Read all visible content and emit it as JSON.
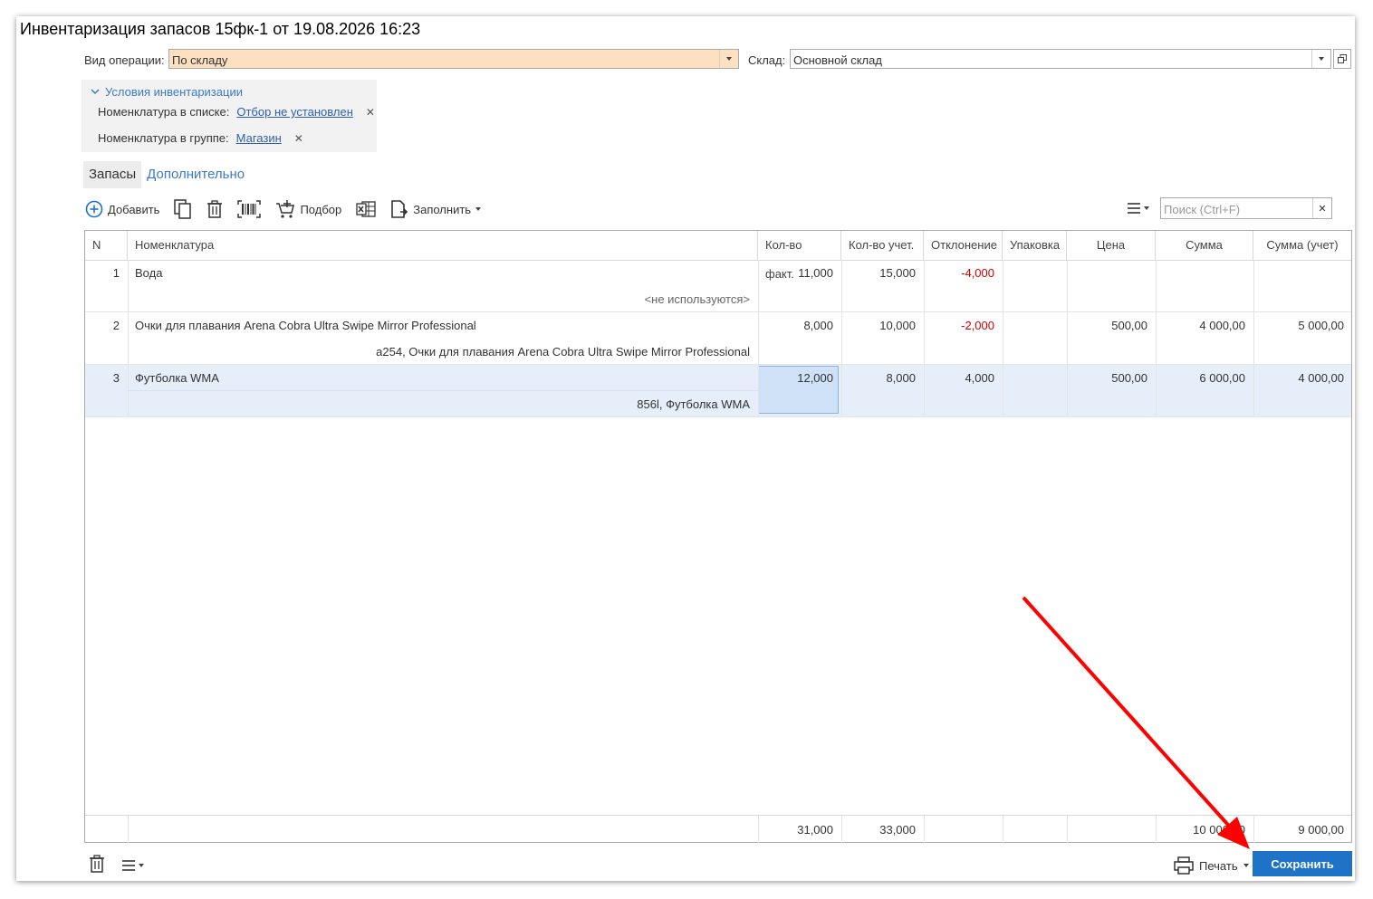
{
  "window": {
    "title": "Инвентаризация запасов 15фк-1 от 19.08.2026 16:23"
  },
  "header": {
    "operation_label": "Вид операции:",
    "operation_value": "По складу",
    "warehouse_label": "Склад:",
    "warehouse_value": "Основной склад"
  },
  "conditions": {
    "title": "Условия инвентаризации",
    "list_label": "Номенклатура в списке:",
    "list_value": "Отбор не установлен",
    "group_label": "Номенклатура в группе:",
    "group_value": "Магазин"
  },
  "tabs": [
    {
      "label": "Запасы"
    },
    {
      "label": "Дополнительно"
    }
  ],
  "toolbar": {
    "add_label": "Добавить",
    "pick_label": "Подбор",
    "fill_label": "Заполнить",
    "search_placeholder": "Поиск (Ctrl+F)"
  },
  "table": {
    "columns": [
      "N",
      "Номенклатура",
      "Кол-во факт.",
      "Кол-во учет.",
      "Отклонение",
      "Упаковка",
      "Цена",
      "Сумма",
      "Сумма (учет)"
    ],
    "rows": [
      {
        "n": "1",
        "name": "Вода",
        "sub": "<не используются>",
        "fact": "11,000",
        "acc": "15,000",
        "dev": "-4,000",
        "pack": "",
        "price": "",
        "sum": "",
        "sum_acc": ""
      },
      {
        "n": "2",
        "name": "Очки для плавания Arena Cobra Ultra Swipe Mirror Professional",
        "sub": "a254, Очки для плавания Arena Cobra Ultra Swipe Mirror Professional",
        "fact": "8,000",
        "acc": "10,000",
        "dev": "-2,000",
        "pack": "",
        "price": "500,00",
        "sum": "4 000,00",
        "sum_acc": "5 000,00"
      },
      {
        "n": "3",
        "name": "Футболка WMA",
        "sub": "856l, Футболка WMA",
        "fact": "12,000",
        "acc": "8,000",
        "dev": "4,000",
        "pack": "",
        "price": "500,00",
        "sum": "6 000,00",
        "sum_acc": "4 000,00"
      }
    ],
    "totals": {
      "fact": "31,000",
      "acc": "33,000",
      "sum": "10 000,00",
      "sum_acc": "9 000,00"
    }
  },
  "bottom": {
    "print_label": "Печать",
    "save_label": "Сохранить"
  },
  "colors": {
    "accent": "#1e73c8",
    "link": "#2f5fb0",
    "negative": "#d40000",
    "operation_bg": "#fde0c0",
    "selected_row": "#e5eef9",
    "annotation_arrow": "#ff0000"
  }
}
